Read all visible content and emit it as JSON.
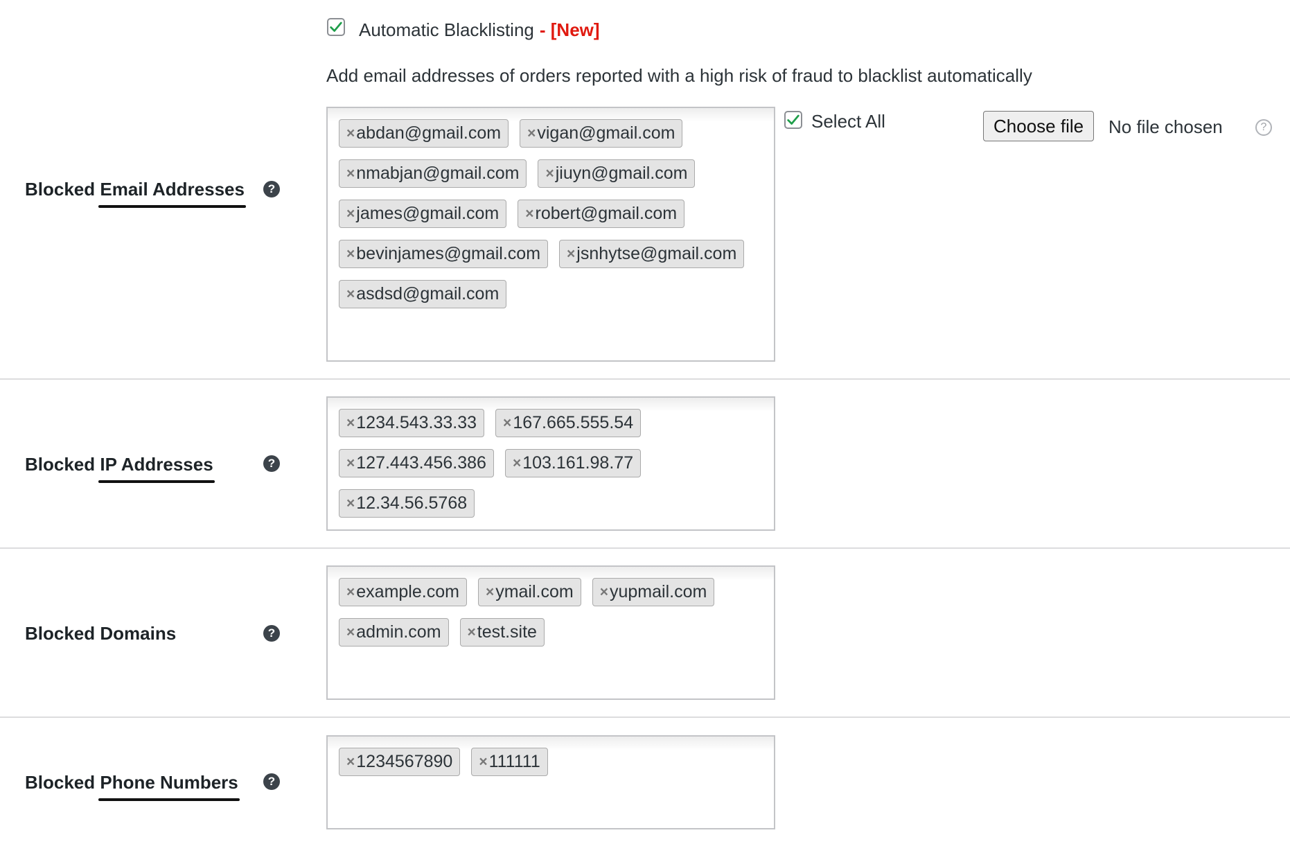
{
  "auto_blacklist": {
    "checked": true,
    "label": "Automatic Blacklisting",
    "new_tag": "- [New]",
    "description": "Add email addresses of orders reported with a high risk of fraud to blacklist automatically"
  },
  "email_row": {
    "label_prefix": "Blocked ",
    "label_emphasis": "Email Addresses",
    "tags": [
      "abdan@gmail.com",
      "vigan@gmail.com",
      "nmabjan@gmail.com",
      "jiuyn@gmail.com",
      "james@gmail.com",
      "robert@gmail.com",
      "bevinjames@gmail.com",
      "jsnhytse@gmail.com",
      "asdsd@gmail.com"
    ],
    "select_all_label": "Select All",
    "select_all_checked": true,
    "choose_file_label": "Choose file",
    "no_file_text": "No file chosen"
  },
  "ip_row": {
    "label_prefix": "Blocked ",
    "label_emphasis": "IP Addresses",
    "tags": [
      "1234.543.33.33",
      "167.665.555.54",
      "127.443.456.386",
      "103.161.98.77",
      "12.34.56.5768"
    ]
  },
  "domain_row": {
    "label": "Blocked Domains",
    "tags": [
      "example.com",
      "ymail.com",
      "yupmail.com",
      "admin.com",
      "test.site"
    ]
  },
  "phone_row": {
    "label_prefix": "Blocked ",
    "label_emphasis": "Phone Numbers",
    "tags": [
      "1234567890",
      "111111"
    ]
  },
  "icons": {
    "help": "?",
    "remove": "×",
    "checkmark": "check-icon"
  },
  "colors": {
    "check_green": "#1e9e4a",
    "new_red": "#e0190f",
    "tag_bg": "#e4e4e4"
  }
}
